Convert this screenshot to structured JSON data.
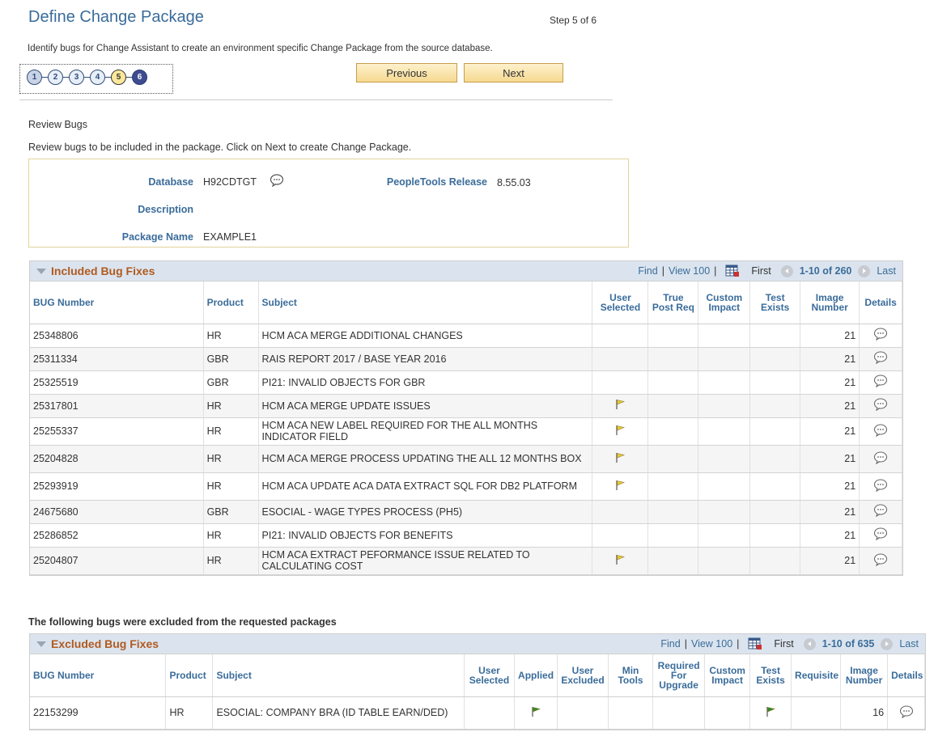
{
  "page": {
    "title": "Define Change Package",
    "step_label": "Step 5 of 6",
    "instruction": "Identify bugs for Change Assistant to create an environment specific Change Package from the source database."
  },
  "train": {
    "steps": [
      "1",
      "2",
      "3",
      "4",
      "5",
      "6"
    ],
    "current_step": 5
  },
  "buttons": {
    "previous": "Previous",
    "next": "Next"
  },
  "review": {
    "heading": "Review Bugs",
    "text": "Review bugs to be included in the package.  Click on Next to create Change Package."
  },
  "info": {
    "database_label": "Database",
    "database_value": "H92CDTGT",
    "tools_label": "PeopleTools Release",
    "tools_value": "8.55.03",
    "description_label": "Description",
    "description_value": "",
    "package_label": "Package Name",
    "package_value": "EXAMPLE1"
  },
  "included": {
    "title": "Included Bug Fixes",
    "find": "Find",
    "view": "View 100",
    "first": "First",
    "range": "1-10 of 260",
    "last": "Last",
    "columns": [
      "BUG Number",
      "Product",
      "Subject",
      "User Selected",
      "True Post Req",
      "Custom Impact",
      "Test Exists",
      "Image Number",
      "Details"
    ],
    "rows": [
      {
        "bug": "25348806",
        "product": "HR",
        "subject": "HCM ACA MERGE ADDITIONAL CHANGES",
        "user_selected": false,
        "image": "21"
      },
      {
        "bug": "25311334",
        "product": "GBR",
        "subject": "RAIS REPORT 2017 / BASE YEAR 2016",
        "user_selected": false,
        "image": "21"
      },
      {
        "bug": "25325519",
        "product": "GBR",
        "subject": "PI21: INVALID OBJECTS FOR GBR",
        "user_selected": false,
        "image": "21"
      },
      {
        "bug": "25317801",
        "product": "HR",
        "subject": "HCM ACA MERGE UPDATE ISSUES",
        "user_selected": true,
        "image": "21"
      },
      {
        "bug": "25255337",
        "product": "HR",
        "subject": "HCM ACA NEW LABEL REQUIRED FOR THE ALL MONTHS INDICATOR FIELD",
        "user_selected": true,
        "image": "21"
      },
      {
        "bug": "25204828",
        "product": "HR",
        "subject": "HCM ACA MERGE PROCESS UPDATING THE ALL 12 MONTHS BOX",
        "user_selected": true,
        "image": "21"
      },
      {
        "bug": "25293919",
        "product": "HR",
        "subject": "HCM ACA UPDATE ACA DATA EXTRACT SQL FOR DB2 PLATFORM",
        "user_selected": true,
        "image": "21"
      },
      {
        "bug": "24675680",
        "product": "GBR",
        "subject": "ESOCIAL - WAGE TYPES PROCESS (PH5)",
        "user_selected": false,
        "image": "21"
      },
      {
        "bug": "25286852",
        "product": "HR",
        "subject": "PI21: INVALID OBJECTS FOR BENEFITS",
        "user_selected": false,
        "image": "21"
      },
      {
        "bug": "25204807",
        "product": "HR",
        "subject": "HCM ACA EXTRACT PEFORMANCE ISSUE RELATED TO CALCULATING COST",
        "user_selected": true,
        "image": "21"
      }
    ]
  },
  "excluded_caption": "The following bugs were excluded from the requested packages",
  "excluded": {
    "title": "Excluded Bug Fixes",
    "find": "Find",
    "view": "View 100",
    "first": "First",
    "range": "1-10 of 635",
    "last": "Last",
    "columns": [
      "BUG Number",
      "Product",
      "Subject",
      "User Selected",
      "Applied",
      "User Excluded",
      "Min Tools",
      "Required For Upgrade",
      "Custom Impact",
      "Test Exists",
      "Requisite",
      "Image Number",
      "Details"
    ],
    "rows": [
      {
        "bug": "22153299",
        "product": "HR",
        "subject": "ESOCIAL: COMPANY BRA (ID TABLE EARN/DED)",
        "applied": true,
        "test_exists": true,
        "image": "16"
      }
    ]
  },
  "colors": {
    "title_blue": "#3a6c9a",
    "grid_title": "#b05a20",
    "flag_yellow": "#e8c93a",
    "flag_green": "#2e8b2e"
  }
}
